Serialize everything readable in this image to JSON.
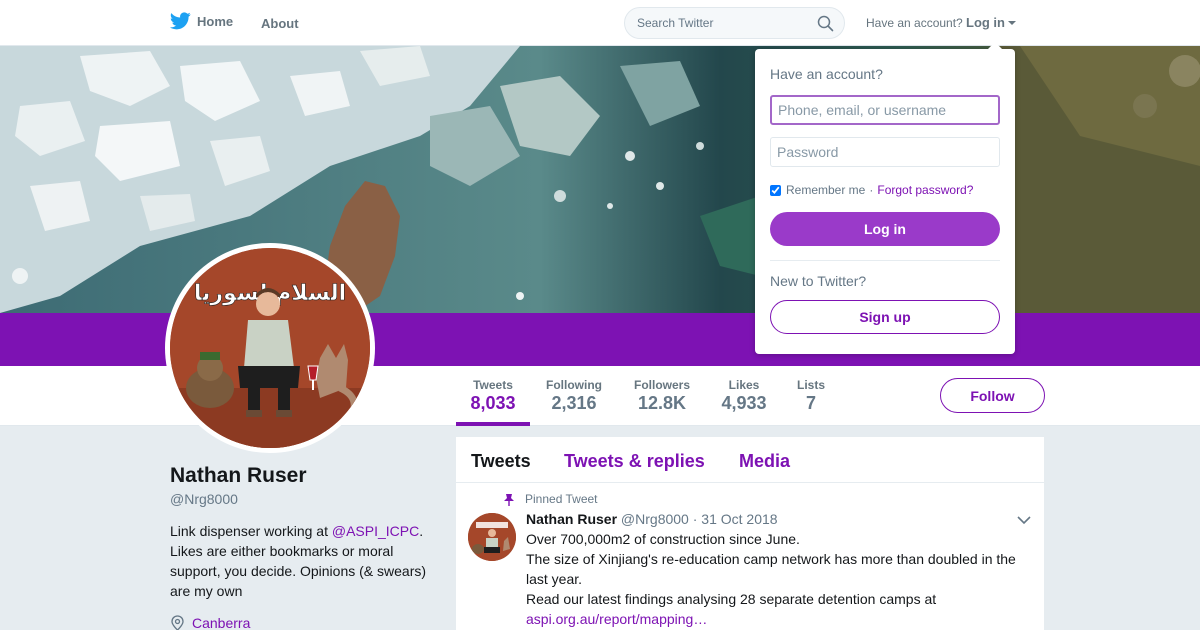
{
  "nav": {
    "home_label": "Home",
    "about_label": "About",
    "search_placeholder": "Search Twitter",
    "have_account": "Have an account?",
    "login_label": "Log in"
  },
  "profile": {
    "name": "Nathan Ruser",
    "handle": "@Nrg8000",
    "bio_prefix": "Link dispenser working at ",
    "bio_mention": "@ASPI_ICPC",
    "bio_suffix": ". Likes are either bookmarks or moral support, you decide. Opinions (& swears) are my own",
    "location": "Canberra",
    "avatar_text": "السلام لسوريا"
  },
  "stats": [
    {
      "label": "Tweets",
      "value": "8,033"
    },
    {
      "label": "Following",
      "value": "2,316"
    },
    {
      "label": "Followers",
      "value": "12.8K"
    },
    {
      "label": "Likes",
      "value": "4,933"
    },
    {
      "label": "Lists",
      "value": "7"
    }
  ],
  "follow_label": "Follow",
  "timeline": {
    "tabs": [
      "Tweets",
      "Tweets & replies",
      "Media"
    ],
    "pinned_label": "Pinned Tweet",
    "tweet": {
      "name": "Nathan Ruser",
      "handle": "@Nrg8000",
      "date": "· 31 Oct 2018",
      "line1": "Over 700,000m2 of construction since June.",
      "line2": "The size of Xinjiang's re-education camp network has more than doubled in the last year.",
      "line3": "Read our latest findings analysing 28 separate detention camps at",
      "link": "aspi.org.au/report/mapping…"
    }
  },
  "login_dropdown": {
    "title": "Have an account?",
    "username_placeholder": "Phone, email, or username",
    "password_placeholder": "Password",
    "remember_label": "Remember me",
    "separator": "·",
    "forgot_label": "Forgot password?",
    "login_button": "Log in",
    "new_label": "New to Twitter?",
    "signup_button": "Sign up"
  },
  "colors": {
    "accent": "#7d12b3",
    "login_button": "#9a3ac9",
    "background": "#e6ecf0",
    "twitter_blue": "#1da1f2"
  }
}
